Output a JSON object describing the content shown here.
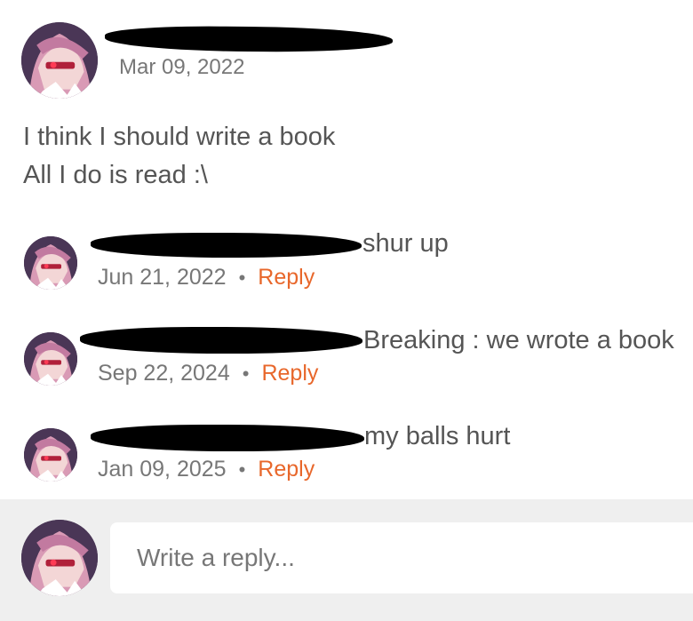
{
  "post": {
    "author_avatar": "anime-avatar-icon",
    "date": "Mar 09, 2022",
    "body_lines": [
      "I think I should write a book",
      "All I do is read :\\"
    ]
  },
  "comments": [
    {
      "text": "shur up",
      "date": "Jun 21, 2022",
      "separator": "•",
      "reply_label": "Reply"
    },
    {
      "text": "Breaking : we wrote a book",
      "date": "Sep 22, 2024",
      "separator": "•",
      "reply_label": "Reply"
    },
    {
      "text": "my balls hurt",
      "date": "Jan 09, 2025",
      "separator": "•",
      "reply_label": "Reply"
    }
  ],
  "reply_box": {
    "placeholder": "Write a reply..."
  },
  "colors": {
    "accent": "#e8672b",
    "text": "#555555",
    "muted": "#777777",
    "bar": "#efefef"
  }
}
